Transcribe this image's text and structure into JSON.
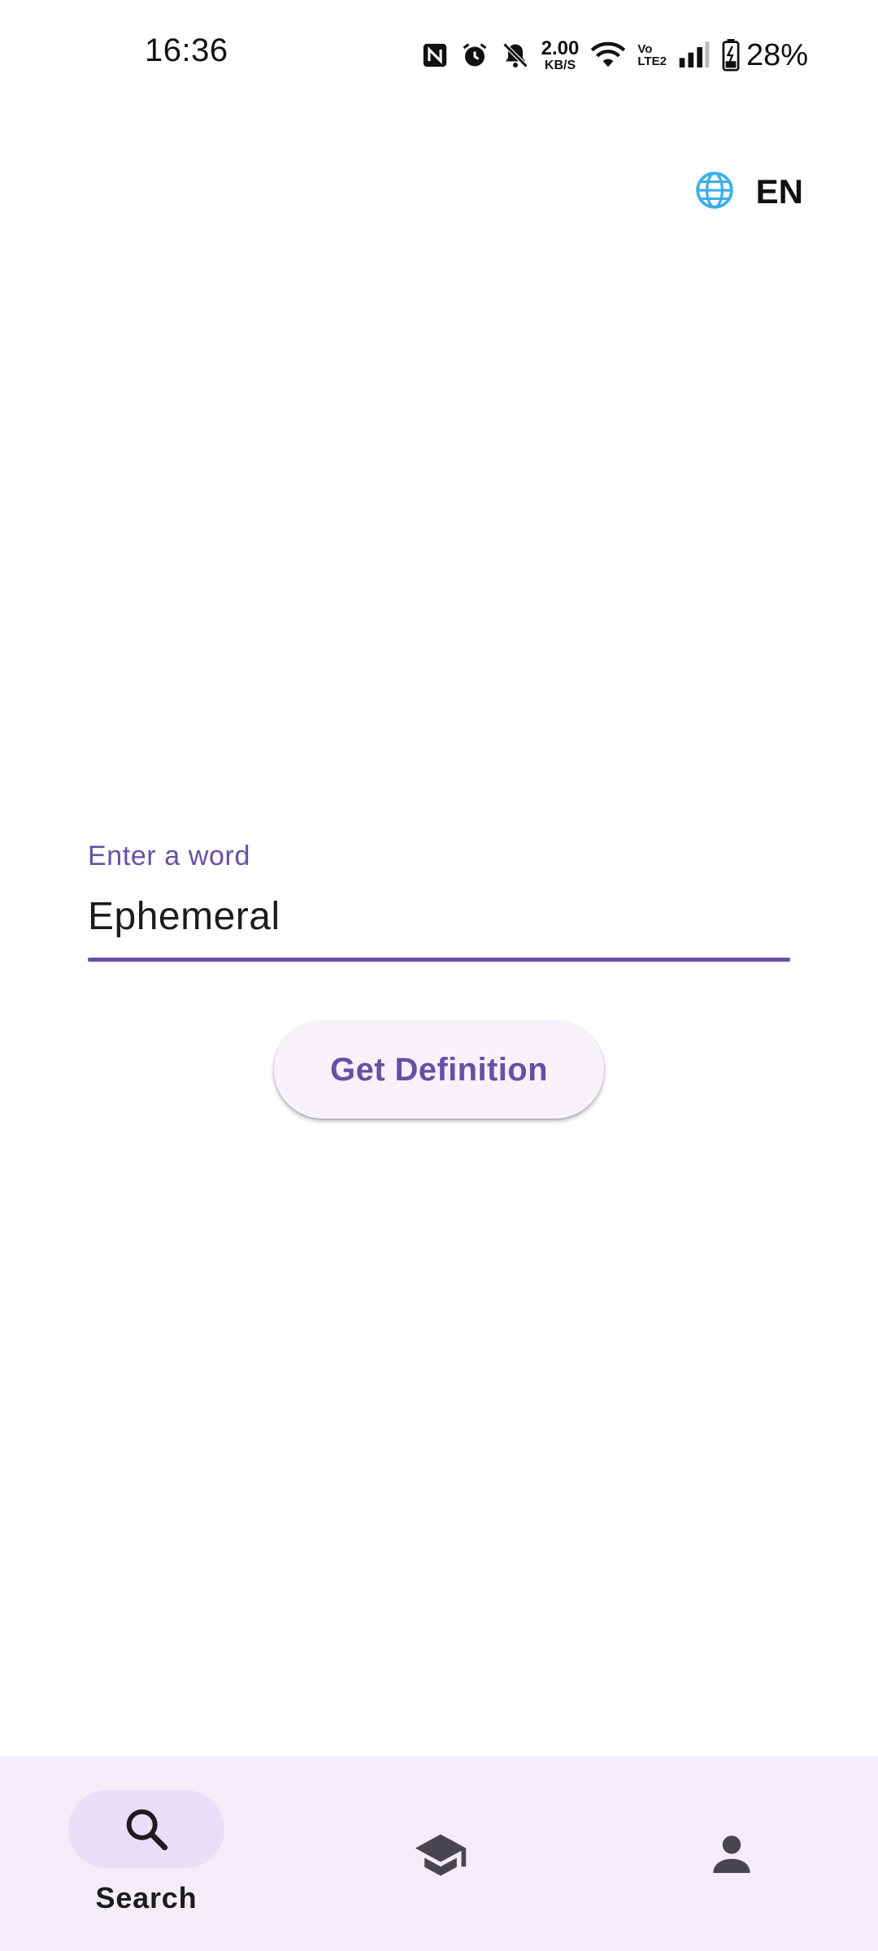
{
  "status_bar": {
    "time": "16:36",
    "net_speed_value": "2.00",
    "net_speed_unit": "KB/S",
    "volte_top": "Vo",
    "volte_bottom": "LTE2",
    "battery_percent": "28%",
    "icons": [
      "nfc-icon",
      "alarm-icon",
      "bell-muted-icon",
      "wifi-icon",
      "signal-icon",
      "battery-charging-icon"
    ]
  },
  "header": {
    "language_icon": "globe-icon",
    "language_code": "EN",
    "accent_color": "#3daee9"
  },
  "search_form": {
    "field_label": "Enter a word",
    "field_value": "Ephemeral",
    "submit_label": "Get Definition",
    "accent_color": "#6750a4"
  },
  "bottom_nav": {
    "items": [
      {
        "label": "Search",
        "icon": "search-icon",
        "selected": true
      },
      {
        "label": "",
        "icon": "graduation-cap-icon",
        "selected": false
      },
      {
        "label": "",
        "icon": "person-icon",
        "selected": false
      }
    ],
    "background": "#f3edf7",
    "selected_indicator": "#e8def8"
  }
}
